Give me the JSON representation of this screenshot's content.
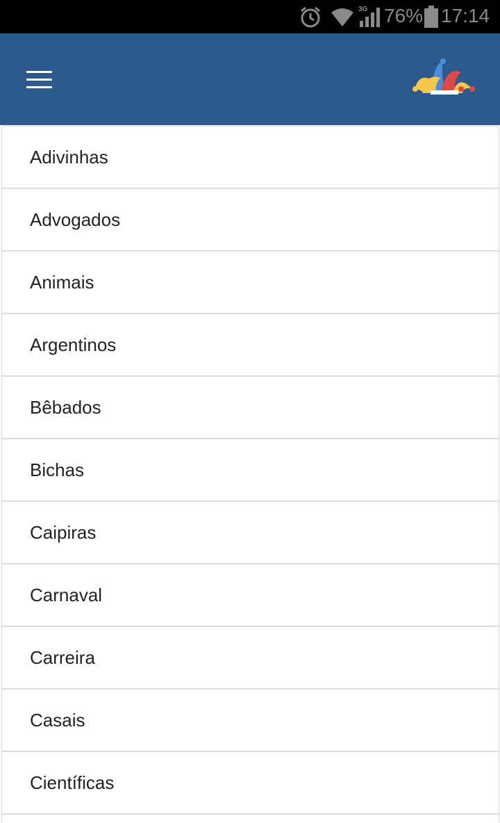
{
  "status_bar": {
    "battery_percent": "76%",
    "time": "17:14",
    "network": "3G",
    "icons": [
      "alarm-icon",
      "wifi-icon",
      "signal-icon",
      "battery-icon"
    ]
  },
  "app_bar": {
    "menu_icon": "hamburger-menu-icon",
    "logo_icon": "jester-hat-icon",
    "colors": {
      "background": "#2d5a8e"
    }
  },
  "categories": [
    {
      "label": "Adivinhas"
    },
    {
      "label": "Advogados"
    },
    {
      "label": "Animais"
    },
    {
      "label": "Argentinos"
    },
    {
      "label": "Bêbados"
    },
    {
      "label": "Bichas"
    },
    {
      "label": "Caipiras"
    },
    {
      "label": "Carnaval"
    },
    {
      "label": "Carreira"
    },
    {
      "label": "Casais"
    },
    {
      "label": "Científicas"
    }
  ]
}
